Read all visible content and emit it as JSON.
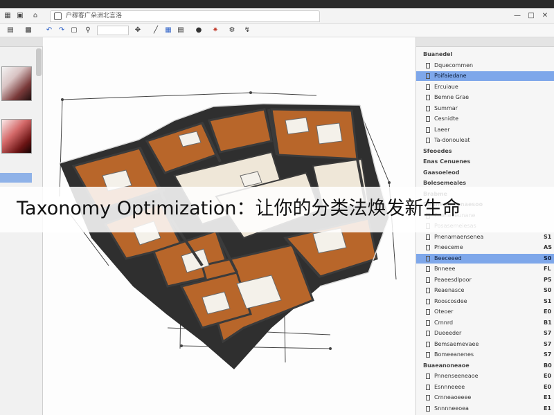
{
  "window": {
    "tab_title": "户稼客广朵洲北言洛"
  },
  "toolbar": {
    "tools": [
      "save-icon",
      "print-icon",
      "undo-icon",
      "redo-icon",
      "zoom-icon",
      "pan-icon",
      "line-tool-icon",
      "wall-tool-icon",
      "fill-icon",
      "render-icon",
      "measure-icon",
      "settings-icon"
    ]
  },
  "banner": {
    "text": "Taxonomy Optimization：让你的分类法焕发新生命"
  },
  "properties": {
    "rows": [
      {
        "label": "Buanedel",
        "group": true,
        "selected": false,
        "value": ""
      },
      {
        "label": "Dquecommen",
        "group": false,
        "selected": false,
        "value": ""
      },
      {
        "label": "Poifaiedane",
        "group": false,
        "selected": true,
        "value": ""
      },
      {
        "label": "Ercuiaue",
        "group": false,
        "selected": false,
        "value": ""
      },
      {
        "label": "Bemne Grae",
        "group": false,
        "selected": false,
        "value": ""
      },
      {
        "label": "Summar",
        "group": false,
        "selected": false,
        "value": ""
      },
      {
        "label": "Cesnidte",
        "group": false,
        "selected": false,
        "value": ""
      },
      {
        "label": "Laeer",
        "group": false,
        "selected": false,
        "value": ""
      },
      {
        "label": "Ta-donouleat",
        "group": false,
        "selected": false,
        "value": ""
      },
      {
        "label": "Sfeoedes",
        "group": true,
        "selected": false,
        "value": ""
      },
      {
        "label": "Enas Cenuenes",
        "group": true,
        "selected": false,
        "value": ""
      },
      {
        "label": "Gaasoeleod",
        "group": true,
        "selected": false,
        "value": ""
      },
      {
        "label": "Bolesemeales",
        "group": true,
        "selected": false,
        "value": ""
      },
      {
        "label": "Brabme",
        "group": true,
        "selected": false,
        "value": ""
      },
      {
        "label": "Pissnemeeenaesoo",
        "group": true,
        "selected": false,
        "value": ""
      },
      {
        "label": "Pneneveunane",
        "group": false,
        "selected": false,
        "value": ""
      },
      {
        "label": "Posasemeiesas",
        "group": false,
        "selected": false,
        "value": ""
      },
      {
        "label": "Pnenamaensenea",
        "group": false,
        "selected": false,
        "value": "S1"
      },
      {
        "label": "Pneeceme",
        "group": false,
        "selected": false,
        "value": "AS"
      },
      {
        "label": "Beeceeed",
        "group": false,
        "selected": true,
        "value": "S0"
      },
      {
        "label": "Bnneee",
        "group": false,
        "selected": false,
        "value": "FL"
      },
      {
        "label": "Peaeesdlpoor",
        "group": false,
        "selected": false,
        "value": "P5"
      },
      {
        "label": "Reaenasce",
        "group": false,
        "selected": false,
        "value": "S0"
      },
      {
        "label": "Rooscosdee",
        "group": false,
        "selected": false,
        "value": "S1"
      },
      {
        "label": "Oteoer",
        "group": false,
        "selected": false,
        "value": "E0"
      },
      {
        "label": "Crnnrd",
        "group": false,
        "selected": false,
        "value": "B1"
      },
      {
        "label": "Dueeeder",
        "group": false,
        "selected": false,
        "value": "S7"
      },
      {
        "label": "Bemsaemevaee",
        "group": false,
        "selected": false,
        "value": "S7"
      },
      {
        "label": "Bomeeanenes",
        "group": false,
        "selected": false,
        "value": "S7"
      },
      {
        "label": "Buaeanoneaoe",
        "group": true,
        "selected": false,
        "value": "B0"
      },
      {
        "label": "Pnnenseeneaoe",
        "group": false,
        "selected": false,
        "value": "E0"
      },
      {
        "label": "Esnnneeee",
        "group": false,
        "selected": false,
        "value": "E0"
      },
      {
        "label": "Crnneaoeeee",
        "group": false,
        "selected": false,
        "value": "E1"
      },
      {
        "label": "Snnnneeoea",
        "group": false,
        "selected": false,
        "value": "E1"
      }
    ]
  },
  "colors": {
    "floor_wood": "#b8662a",
    "floor_tile": "#efe7d8",
    "wall_dark": "#3b3b3b",
    "panel_selected": "#7ea7ea"
  }
}
